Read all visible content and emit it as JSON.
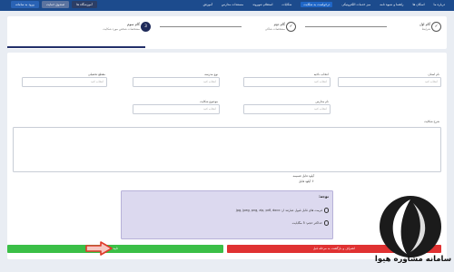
{
  "topbar": {
    "nav": [
      {
        "label": "درباره ما",
        "active": false
      },
      {
        "label": "اسکان ها",
        "active": false
      },
      {
        "label": "راهنما و شیوه نامه",
        "active": false
      },
      {
        "label": "میز خدمات الکترونیکی",
        "active": false
      },
      {
        "label": "درخواست به شکایت",
        "active": true
      },
      {
        "label": "شکایات",
        "active": false
      },
      {
        "label": "استعلام شهروند",
        "active": false
      },
      {
        "label": "مستندات مدارس",
        "active": false
      },
      {
        "label": "آموزش",
        "active": false
      }
    ],
    "buttons": {
      "login": "ورود به سامانه",
      "support": "صندوق حمایت",
      "education": "آموزشگاه ها"
    }
  },
  "stepper": {
    "steps": [
      {
        "number": "",
        "title": "گام اول",
        "subtitle": "شرایط",
        "status": "done"
      },
      {
        "number": "",
        "title": "گام دوم",
        "subtitle": "مشخصات شاکی",
        "status": "done"
      },
      {
        "number": "3",
        "title": "گام سوم",
        "subtitle": "مشخصات شخص مورد شکایت",
        "status": "current"
      }
    ]
  },
  "form": {
    "fields": [
      {
        "label": "نام استان",
        "placeholder": "انتخاب کنید"
      },
      {
        "label": "انتخاب ناحیه",
        "placeholder": "انتخاب کنید"
      },
      {
        "label": "نوع مدرسه",
        "placeholder": "انتخاب کنید"
      },
      {
        "label": "مقطع تحصیلی",
        "placeholder": "انتخاب کنید"
      },
      {
        "label": "نام مدارس",
        "placeholder": "انتخاب کنید"
      },
      {
        "label": "موضوع شکایت",
        "placeholder": "انتخاب کنید"
      }
    ],
    "description_label": "شرح شکایت",
    "upload": {
      "label": "آپلود فایل ضمیمه",
      "button": "آپلود فایل"
    },
    "info": {
      "title": "توجه:",
      "lines": [
        "فرمت های قابل قبول عبارتند از: jpg, jpeg, png, zip, pdf, docx",
        "حداکثر حجم: 5 مگابایت"
      ]
    }
  },
  "actions": {
    "next": "تایید",
    "cancel": "انصراف و بازگشت به مرحله قبل"
  },
  "brand": {
    "text": "سامانه مشاوره هیوا"
  },
  "colors": {
    "topbar": "#1c4b8d",
    "step_current": "#1f2b5a",
    "info_bg": "#dcd9ef",
    "next": "#3bbf47",
    "cancel": "#e03232",
    "arrow": "#e03a2a"
  }
}
